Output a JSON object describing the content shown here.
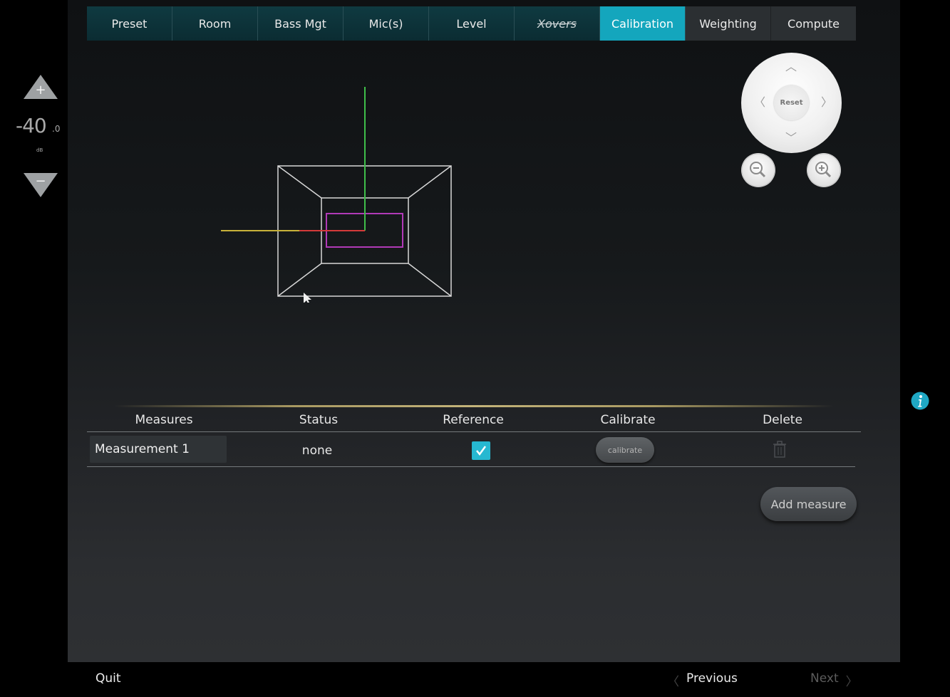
{
  "tabs": [
    {
      "label": "Preset"
    },
    {
      "label": "Room"
    },
    {
      "label": "Bass Mgt"
    },
    {
      "label": "Mic(s)"
    },
    {
      "label": "Level"
    },
    {
      "label": "Xovers"
    },
    {
      "label": "Calibration"
    },
    {
      "label": "Weighting"
    },
    {
      "label": "Compute"
    }
  ],
  "active_tab": "Calibration",
  "volume": {
    "value": "-40",
    "decimal": ".0",
    "unit": "dB"
  },
  "nav_pad": {
    "reset_label": "Reset"
  },
  "table": {
    "headers": [
      "Measures",
      "Status",
      "Reference",
      "Calibrate",
      "Delete"
    ],
    "rows": [
      {
        "name": "Measurement 1",
        "status": "none",
        "reference": true,
        "calibrate_label": "calibrate"
      }
    ]
  },
  "add_measure_label": "Add measure",
  "footer": {
    "quit": "Quit",
    "previous": "Previous",
    "next": "Next"
  },
  "colors": {
    "accent": "#14a6bd",
    "checkbox": "#26b8d1",
    "info": "#1fa8c4"
  }
}
